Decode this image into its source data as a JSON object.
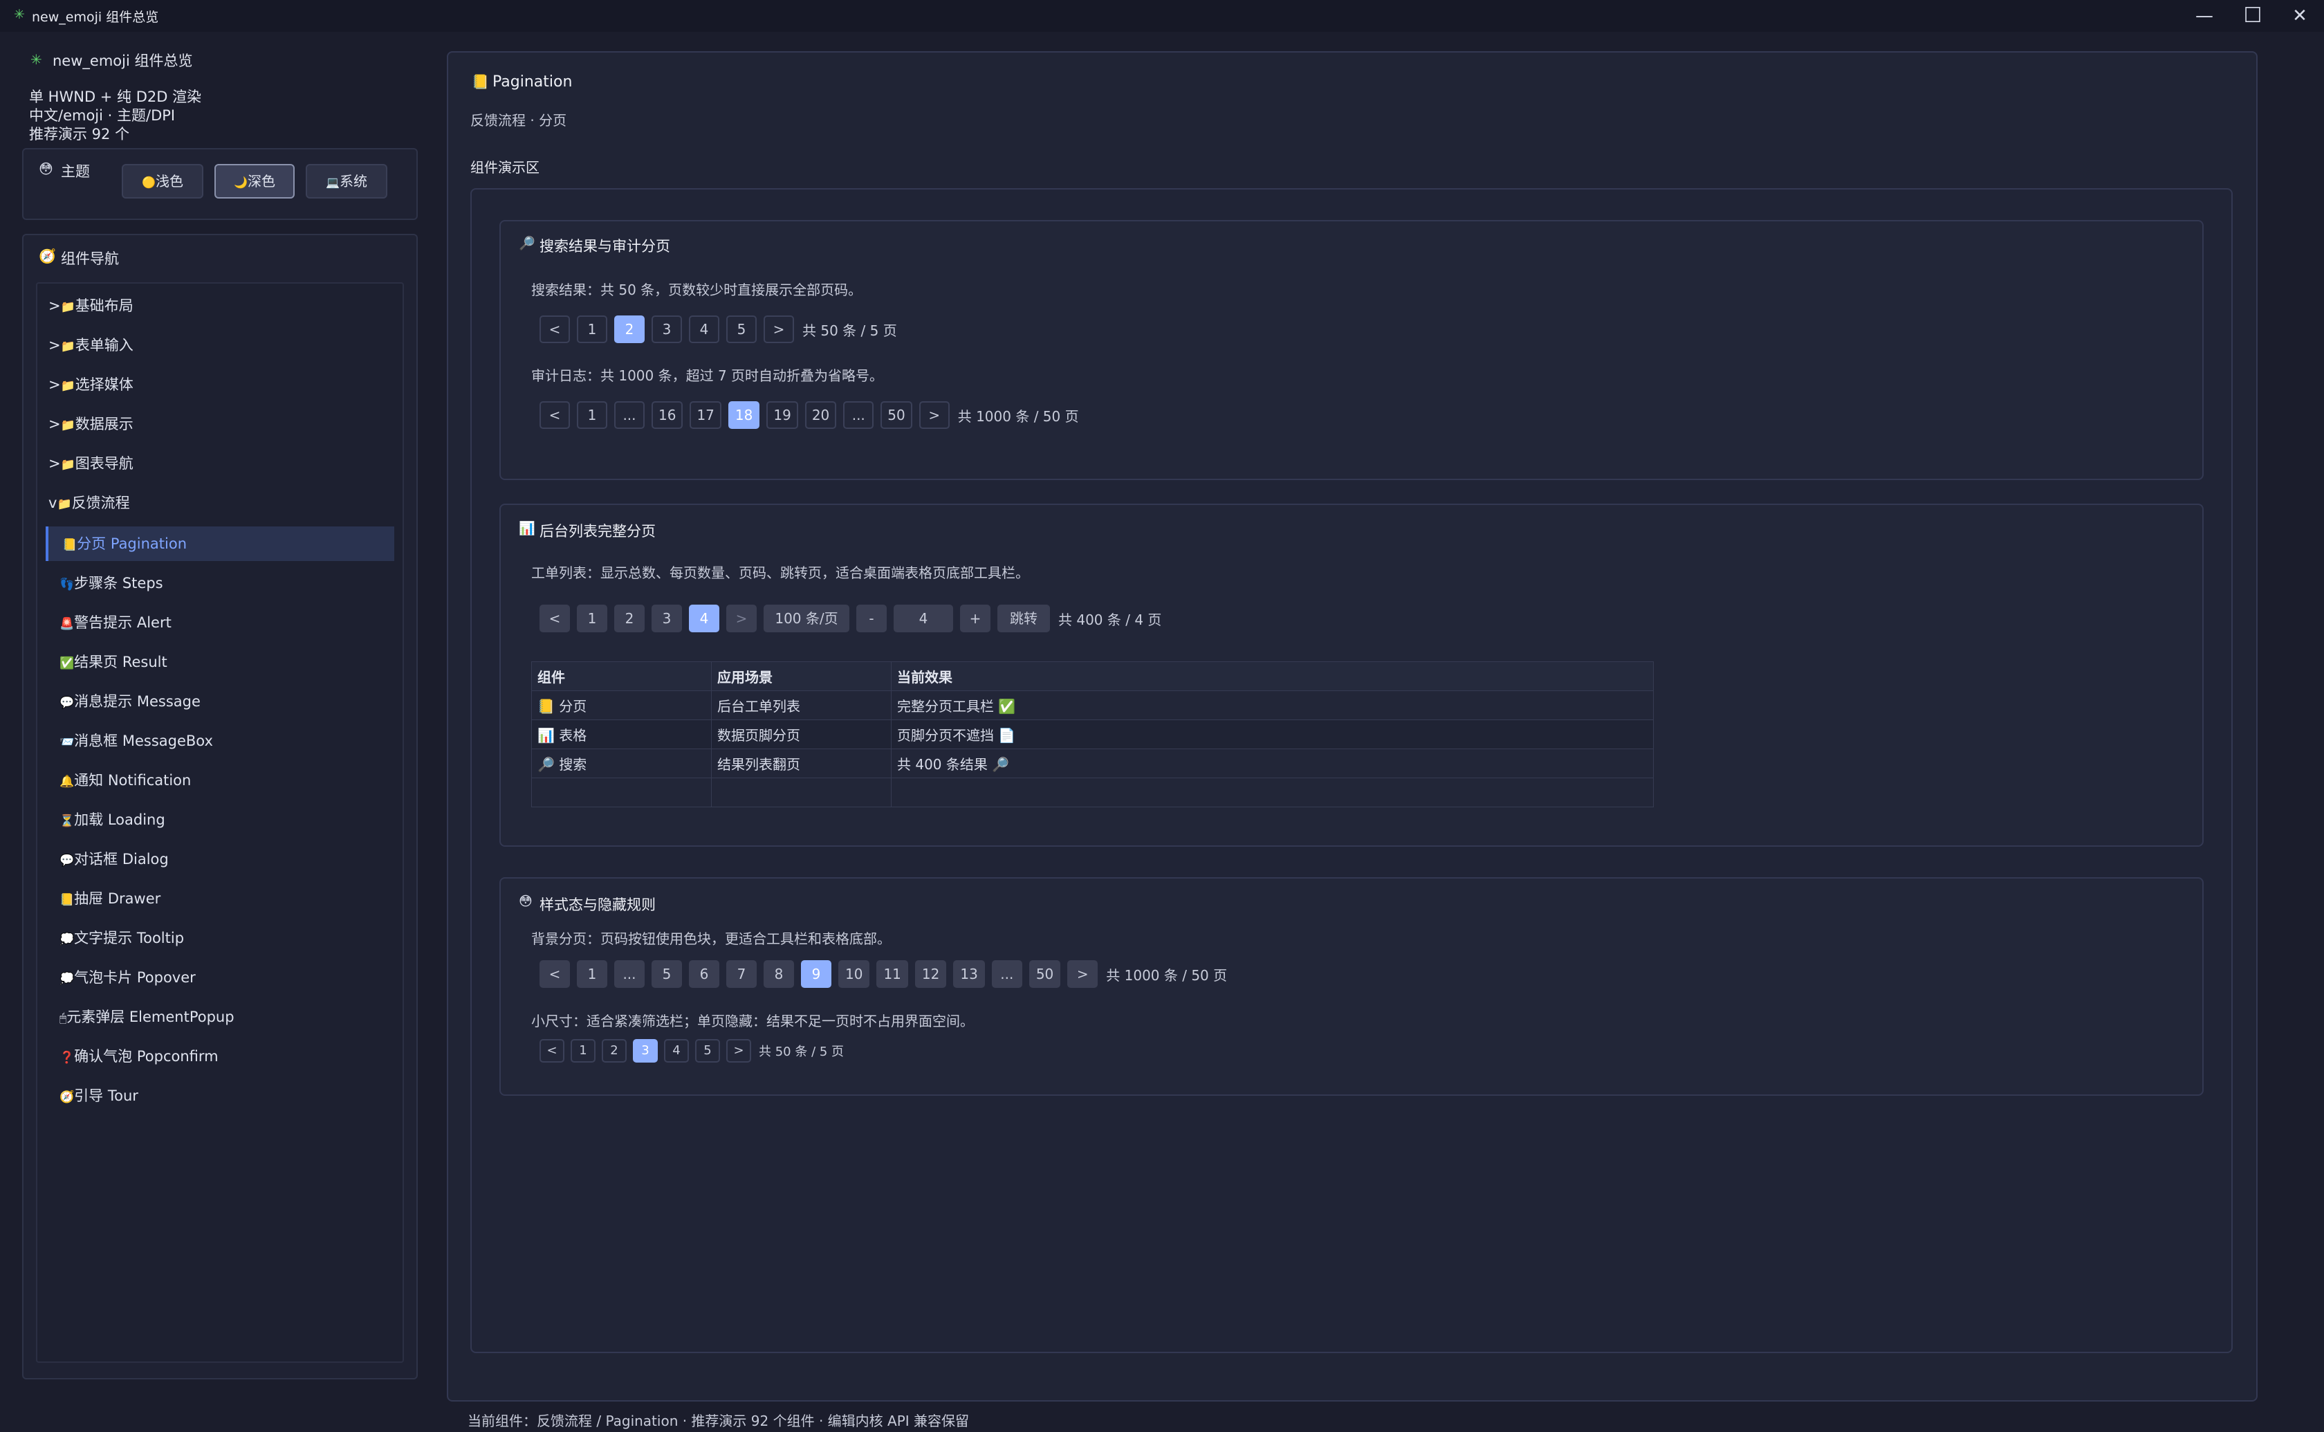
{
  "window": {
    "title": "new_emoji 组件总览",
    "app_icon": "✳",
    "controls": {
      "minimize": "—",
      "maximize": "☐",
      "close": "✕"
    }
  },
  "sidebar": {
    "app_title": "new_emoji 组件总览",
    "info_lines": [
      "单 HWND + 纯 D2D 渲染",
      "中文/emoji · 主题/DPI",
      "推荐演示 92 个"
    ],
    "theme": {
      "label": "主题",
      "icon": "😳",
      "buttons": [
        {
          "icon": "🟡",
          "label": "浅色"
        },
        {
          "icon": "🌙",
          "label": "深色"
        },
        {
          "icon": "💻",
          "label": "系统"
        }
      ],
      "selected": "深色"
    },
    "nav": {
      "label": "组件导航",
      "icon": "🧭",
      "groups": [
        {
          "prefix": ">",
          "label": "基础布局"
        },
        {
          "prefix": ">",
          "label": "表单输入"
        },
        {
          "prefix": ">",
          "label": "选择媒体"
        },
        {
          "prefix": ">",
          "label": "数据展示"
        },
        {
          "prefix": ">",
          "label": "图表导航"
        },
        {
          "prefix": "v",
          "label": "反馈流程"
        }
      ],
      "items": [
        {
          "icon": "📒",
          "label": "分页 Pagination"
        },
        {
          "icon": "👣",
          "label": "步骤条 Steps"
        },
        {
          "icon": "🚨",
          "label": "警告提示 Alert"
        },
        {
          "icon": "✅",
          "label": "结果页 Result"
        },
        {
          "icon": "💬",
          "label": "消息提示 Message"
        },
        {
          "icon": "📨",
          "label": "消息框 MessageBox"
        },
        {
          "icon": "🔔",
          "label": "通知 Notification"
        },
        {
          "icon": "⏳",
          "label": "加载 Loading"
        },
        {
          "icon": "💬",
          "label": "对话框 Dialog"
        },
        {
          "icon": "📒",
          "label": "抽屉 Drawer"
        },
        {
          "icon": "💭",
          "label": "文字提示 Tooltip"
        },
        {
          "icon": "💭",
          "label": "气泡卡片 Popover"
        },
        {
          "icon": "🖱",
          "label": "元素弹层 ElementPopup"
        },
        {
          "icon": "❓",
          "label": "确认气泡 Popconfirm"
        },
        {
          "icon": "🧭",
          "label": "引导 Tour"
        }
      ],
      "selected_index": 0
    }
  },
  "main": {
    "header_icon": "📒",
    "title": "Pagination",
    "subtitle": "反馈流程 · 分页",
    "demo_area_label": "组件演示区",
    "section1": {
      "icon": "🔎",
      "title": "搜索结果与审计分页",
      "desc1": "搜索结果：共 50 条，页数较少时直接展示全部页码。",
      "pager1": {
        "pages": [
          "<",
          "1",
          "2",
          "3",
          "4",
          "5",
          ">"
        ],
        "active": "2",
        "total": "共 50 条 / 5 页"
      },
      "desc2": "审计日志：共 1000 条，超过 7 页时自动折叠为省略号。",
      "pager2": {
        "pages": [
          "<",
          "1",
          "...",
          "16",
          "17",
          "18",
          "19",
          "20",
          "...",
          "50",
          ">"
        ],
        "active": "18",
        "total": "共 1000 条 / 50 页"
      }
    },
    "section2": {
      "icon": "📊",
      "title": "后台列表完整分页",
      "desc": "工单列表：显示总数、每页数量、页码、跳转页，适合桌面端表格页底部工具栏。",
      "pager": {
        "pages": [
          "<",
          "1",
          "2",
          "3",
          "4",
          ">"
        ],
        "active": "4",
        "page_size": "100 条/页",
        "minus": "-",
        "jump_value": "4",
        "plus": "+",
        "jump_label": "跳转",
        "total": "共 400 条 / 4 页"
      },
      "table": {
        "headers": [
          "组件",
          "应用场景",
          "当前效果"
        ],
        "rows": [
          [
            "📒 分页",
            "后台工单列表",
            "完整分页工具栏 ✅"
          ],
          [
            "📊 表格",
            "数据页脚分页",
            "页脚分页不遮挡 📄"
          ],
          [
            "🔎 搜索",
            "结果列表翻页",
            "共 400 条结果 🔎"
          ],
          [
            "",
            "",
            ""
          ]
        ]
      }
    },
    "section3": {
      "icon": "😳",
      "title": "样式态与隐藏规则",
      "desc1": "背景分页：页码按钮使用色块，更适合工具栏和表格底部。",
      "pager1": {
        "pages": [
          "<",
          "1",
          "...",
          "5",
          "6",
          "7",
          "8",
          "9",
          "10",
          "11",
          "12",
          "13",
          "...",
          "50",
          ">"
        ],
        "active": "9",
        "total": "共 1000 条 / 50 页"
      },
      "desc2": "小尺寸：适合紧凑筛选栏；单页隐藏：结果不足一页时不占用界面空间。",
      "pager2": {
        "pages": [
          "<",
          "1",
          "2",
          "3",
          "4",
          "5",
          ">"
        ],
        "active": "3",
        "total": "共 50 条 / 5 页"
      }
    }
  },
  "status": "当前组件：反馈流程 / Pagination · 推荐演示 92 个组件 · 编辑内核 API 兼容保留",
  "colors": {
    "accent": "#8fb0ff",
    "selected_nav_text": "#7fa5ff",
    "background": "#1b1d2c"
  }
}
